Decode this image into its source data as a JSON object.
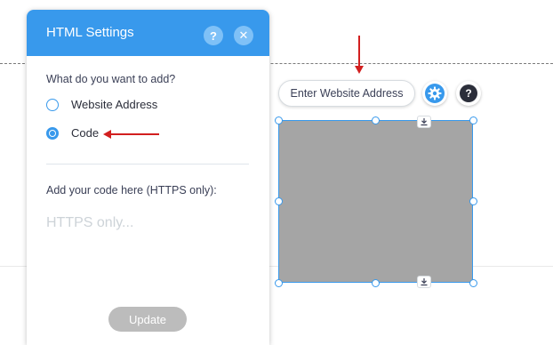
{
  "panel": {
    "title": "HTML Settings",
    "help_label": "?",
    "close_label": "✕",
    "question": "What do you want to add?",
    "options": [
      {
        "label": "Website Address",
        "selected": false
      },
      {
        "label": "Code",
        "selected": true
      }
    ],
    "code_label": "Add your code here (HTTPS only):",
    "code_value": "",
    "code_placeholder": "HTTPS only...",
    "update_label": "Update"
  },
  "toolbar": {
    "enter_address_label": "Enter Website Address",
    "help_label": "?",
    "settings_icon": "gear-icon"
  },
  "colors": {
    "accent": "#3899ec",
    "annotation_arrow": "#d21f1f",
    "element_fill": "#a5a5a5",
    "disabled_button": "#bcbcbc"
  }
}
